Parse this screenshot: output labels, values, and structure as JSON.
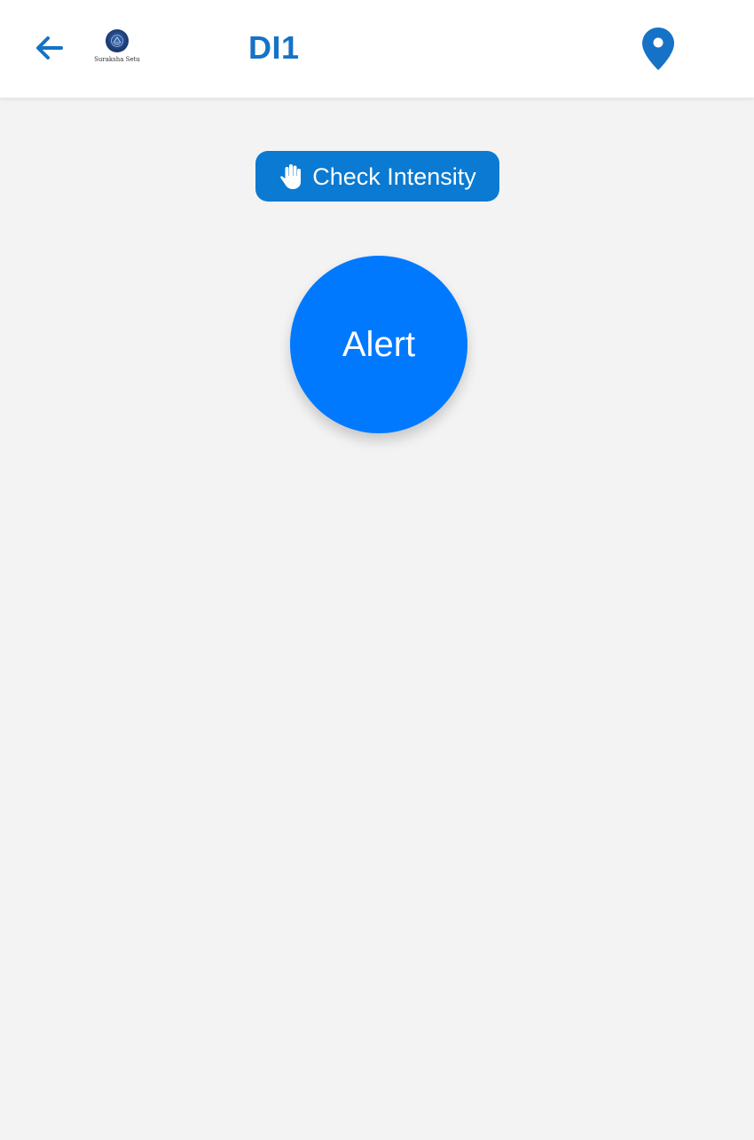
{
  "header": {
    "back_icon": "arrow-left-icon",
    "logo_text": "Suraksha Setu",
    "title": "DI1",
    "location_icon": "map-pin-icon"
  },
  "main": {
    "check_intensity": {
      "icon": "hand-stop-icon",
      "label": "Check Intensity"
    },
    "alert_button_label": "Alert"
  },
  "colors": {
    "header_bg": "#ffffff",
    "page_bg": "#f3f3f3",
    "accent": "#1572c6",
    "check_button_bg": "#0a7ad2",
    "alert_button_bg": "#0079ff"
  }
}
